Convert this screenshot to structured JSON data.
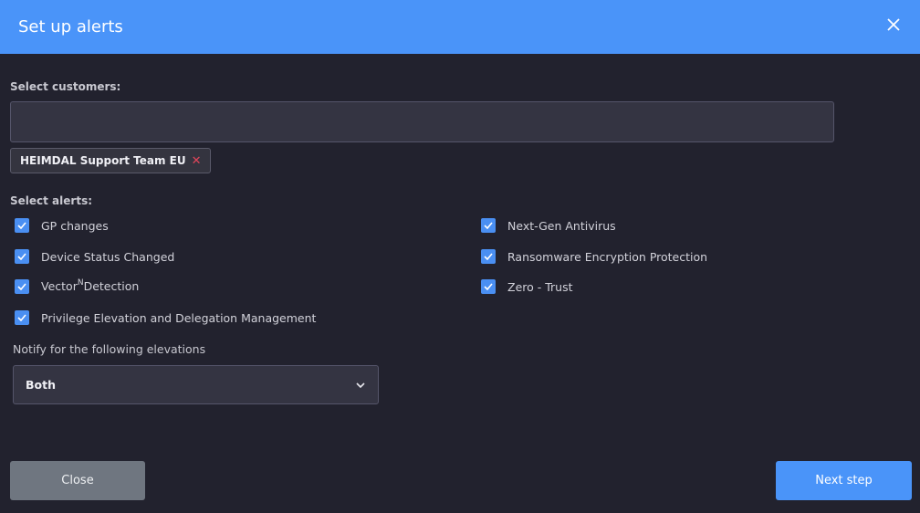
{
  "dialog": {
    "title": "Set up alerts"
  },
  "customers": {
    "label": "Select customers:",
    "input_value": "",
    "input_placeholder": "",
    "selected": [
      {
        "label": "HEIMDAL Support Team EU"
      }
    ]
  },
  "alerts": {
    "label": "Select alerts:",
    "left": [
      {
        "label": "GP changes",
        "checked": true
      },
      {
        "label": "Device Status Changed",
        "checked": true
      },
      {
        "label_main": "Vector",
        "label_sup": "N",
        "label_tail": "Detection",
        "checked": true
      },
      {
        "label": "Privilege Elevation and Delegation Management",
        "checked": true
      }
    ],
    "right": [
      {
        "label": "Next-Gen Antivirus",
        "checked": true
      },
      {
        "label": "Ransomware Encryption Protection",
        "checked": true
      },
      {
        "label": "Zero - Trust",
        "checked": true
      }
    ]
  },
  "elevations": {
    "label": "Notify for the following elevations",
    "selected": "Both"
  },
  "buttons": {
    "close": "Close",
    "next": "Next step"
  },
  "colors": {
    "header": "#4a94f9",
    "background": "#22222e",
    "checkbox": "#4a8ff2",
    "chip_remove": "#e0455a",
    "close_button": "#6f7680"
  }
}
